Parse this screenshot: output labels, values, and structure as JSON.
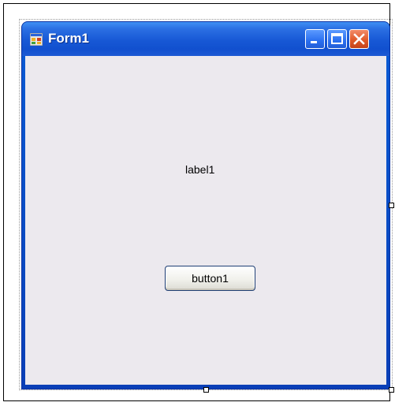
{
  "window": {
    "title": "Form1",
    "app_icon": "form-app-icon",
    "controls": {
      "minimize_icon": "minimize-icon",
      "maximize_icon": "maximize-icon",
      "close_icon": "close-icon"
    }
  },
  "form": {
    "label_text": "label1",
    "button_text": "button1"
  },
  "colors": {
    "title_bar": "#1758d5",
    "client_area": "#ece9ee",
    "close_button": "#e05a2a"
  }
}
